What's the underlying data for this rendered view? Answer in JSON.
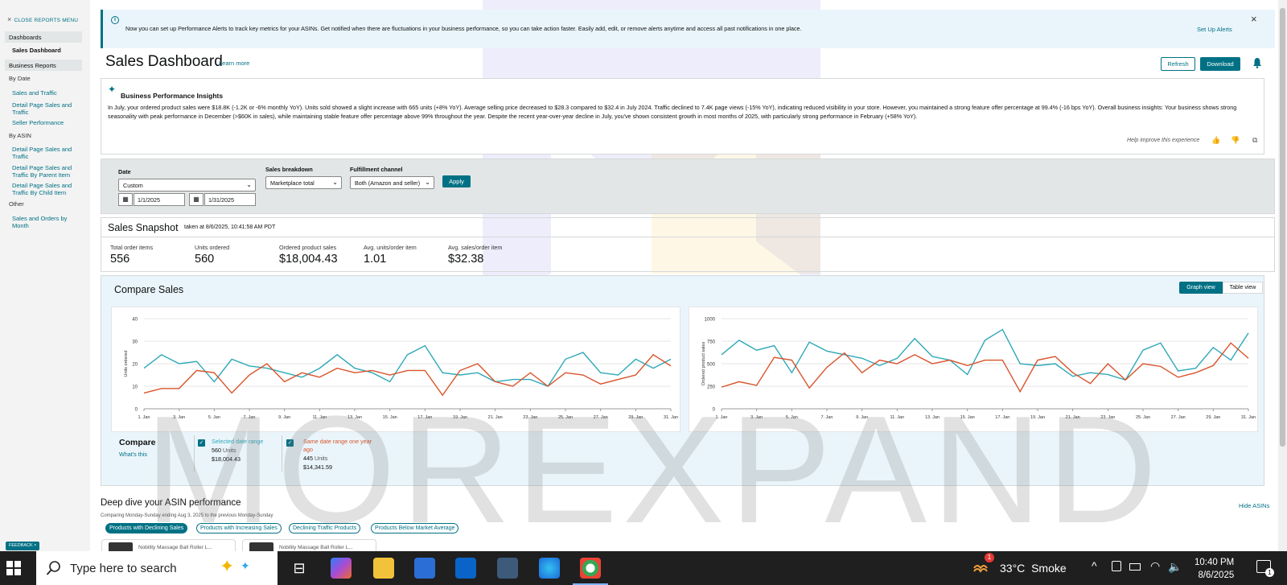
{
  "sidebar": {
    "close_menu": "CLOSE REPORTS MENU",
    "dashboards_head": "Dashboards",
    "sales_dashboard": "Sales Dashboard",
    "business_reports_head": "Business Reports",
    "by_date": "By Date",
    "by_date_items": [
      "Sales and Traffic",
      "Detail Page Sales and Traffic",
      "Seller Performance"
    ],
    "by_asin": "By ASIN",
    "by_asin_items": [
      "Detail Page Sales and Traffic",
      "Detail Page Sales and Traffic By Parent Item",
      "Detail Page Sales and Traffic By Child Item"
    ],
    "other": "Other",
    "other_items": [
      "Sales and Orders by Month"
    ]
  },
  "alert": {
    "message": "Now you can set up Performance Alerts to track key metrics for your ASINs. Get notified when there are fluctuations in your business performance, so you can take action faster. Easily add, edit, or remove alerts anytime and access all past notifications in one place.",
    "setup_link": "Set Up Alerts",
    "info_icon": "i"
  },
  "header": {
    "title": "Sales Dashboard",
    "learn_more": "Learn more",
    "refresh": "Refresh",
    "download": "Download"
  },
  "insights": {
    "heading": "Business Performance Insights",
    "body": "In July, your ordered product sales were $18.8K (-1.2K or -6% monthly YoY). Units sold showed a slight increase with 665 units (+8% YoY). Average selling price decreased to $28.3 compared to $32.4 in July 2024. Traffic declined to 7.4K page views (-15% YoY), indicating reduced visibility in your store. However, you maintained a strong feature offer percentage at 99.4% (-16 bps YoY). Overall business insights: Your business shows strong seasonality with peak performance in December (>$60K in sales), while maintaining stable feature offer percentage above 99% throughout the year. Despite the recent year-over-year decline in July, you've shown consistent growth in most months of 2025, with particularly strong performance in February (+58% YoY).",
    "help": "Help improve this experience"
  },
  "filters": {
    "date_label": "Date",
    "date_value": "Custom",
    "start_date": "1/1/2025",
    "end_date": "1/31/2025",
    "breakdown_label": "Sales breakdown",
    "breakdown_value": "Marketplace total",
    "fulfillment_label": "Fulfillment channel",
    "fulfillment_value": "Both (Amazon and seller)",
    "apply": "Apply"
  },
  "snapshot": {
    "title": "Sales Snapshot",
    "taken": "taken at 8/6/2025, 10:41:58 AM PDT",
    "metrics": [
      {
        "label": "Total order items",
        "value": "556"
      },
      {
        "label": "Units ordered",
        "value": "560"
      },
      {
        "label": "Ordered product sales",
        "value": "$18,004.43"
      },
      {
        "label": "Avg. units/order item",
        "value": "1.01"
      },
      {
        "label": "Avg. sales/order item",
        "value": "$32.38"
      }
    ]
  },
  "compare": {
    "title": "Compare Sales",
    "graph_view": "Graph view",
    "table_view": "Table view",
    "compare_label": "Compare",
    "whats_this": "What's this",
    "selected": {
      "label": "Selected date range",
      "units": "560",
      "units_suffix": "Units",
      "sales": "$18,004.43"
    },
    "last_year": {
      "label": "Same date range one year ago",
      "units": "445",
      "units_suffix": "Units",
      "sales": "$14,341.59"
    }
  },
  "colors": {
    "current": "#2ea8b8",
    "previous": "#d9532b",
    "accent": "#007185"
  },
  "chart_data": [
    {
      "type": "line",
      "ylabel": "Units ordered",
      "ylim": [
        0,
        40
      ],
      "yticks": [
        0,
        10,
        20,
        30,
        40
      ],
      "x_ticks": [
        "1. Jan",
        "3. Jan",
        "5. Jan",
        "7. Jan",
        "9. Jan",
        "11. Jan",
        "13. Jan",
        "15. Jan",
        "17. Jan",
        "19. Jan",
        "21. Jan",
        "23. Jan",
        "25. Jan",
        "27. Jan",
        "29. Jan",
        "31. Jan"
      ],
      "x": [
        1,
        2,
        3,
        4,
        5,
        6,
        7,
        8,
        9,
        10,
        11,
        12,
        13,
        14,
        15,
        16,
        17,
        18,
        19,
        20,
        21,
        22,
        23,
        24,
        25,
        26,
        27,
        28,
        29,
        30,
        31
      ],
      "series": [
        {
          "name": "Selected date range",
          "color": "#2ea8b8",
          "values": [
            18,
            24,
            20,
            21,
            12,
            22,
            19,
            18,
            16,
            14,
            18,
            24,
            18,
            16,
            12,
            24,
            28,
            16,
            15,
            16,
            12,
            13,
            13,
            10,
            22,
            25,
            16,
            15,
            22,
            18,
            22
          ]
        },
        {
          "name": "Same date range one year ago",
          "color": "#d9532b",
          "values": [
            7,
            9,
            9,
            17,
            16,
            7,
            15,
            20,
            12,
            16,
            14,
            18,
            16,
            17,
            15,
            17,
            17,
            6,
            17,
            20,
            12,
            10,
            16,
            10,
            16,
            15,
            11,
            13,
            15,
            24,
            19
          ]
        }
      ]
    },
    {
      "type": "line",
      "ylabel": "Ordered product sales",
      "ylim": [
        0,
        1000
      ],
      "yticks": [
        0,
        250,
        500,
        750,
        1000
      ],
      "x_ticks": [
        "1. Jan",
        "3. Jan",
        "5. Jan",
        "7. Jan",
        "9. Jan",
        "11. Jan",
        "13. Jan",
        "15. Jan",
        "17. Jan",
        "19. Jan",
        "21. Jan",
        "23. Jan",
        "25. Jan",
        "27. Jan",
        "29. Jan",
        "31. Jan"
      ],
      "x": [
        1,
        2,
        3,
        4,
        5,
        6,
        7,
        8,
        9,
        10,
        11,
        12,
        13,
        14,
        15,
        16,
        17,
        18,
        19,
        20,
        21,
        22,
        23,
        24,
        25,
        26,
        27,
        28,
        29,
        30,
        31
      ],
      "series": [
        {
          "name": "Selected date range",
          "color": "#2ea8b8",
          "values": [
            600,
            760,
            650,
            700,
            400,
            740,
            640,
            600,
            560,
            480,
            560,
            780,
            580,
            540,
            380,
            760,
            880,
            500,
            480,
            500,
            360,
            400,
            380,
            320,
            650,
            730,
            420,
            450,
            680,
            540,
            840
          ]
        },
        {
          "name": "Same date range one year ago",
          "color": "#d9532b",
          "values": [
            240,
            300,
            260,
            570,
            540,
            230,
            460,
            620,
            400,
            540,
            500,
            600,
            500,
            540,
            480,
            540,
            540,
            190,
            540,
            580,
            400,
            280,
            500,
            320,
            500,
            470,
            350,
            400,
            480,
            730,
            560
          ]
        }
      ]
    }
  ],
  "deepdive": {
    "title": "Deep dive your ASIN performance",
    "subtitle": "Comparing Monday-Sunday ending Aug 3, 2025 to the previous Monday-Sunday",
    "hide": "Hide ASINs",
    "pills": [
      "Products with Declining Sales",
      "Products with Increasing Sales",
      "Declining Traffic Products",
      "Products Below Market Average"
    ],
    "products": [
      "Nobility Massage Ball Roller L...",
      "Nobility Massage Ball Roller L..."
    ]
  },
  "feedback": "FEEDBACK",
  "watermark": "MOREXPAND",
  "taskbar": {
    "search_placeholder": "Type here to search",
    "temperature": "33°C",
    "weather": "Smoke",
    "time": "10:40 PM",
    "date": "8/6/2025",
    "notif_count": "1",
    "weather_badge": "1"
  }
}
